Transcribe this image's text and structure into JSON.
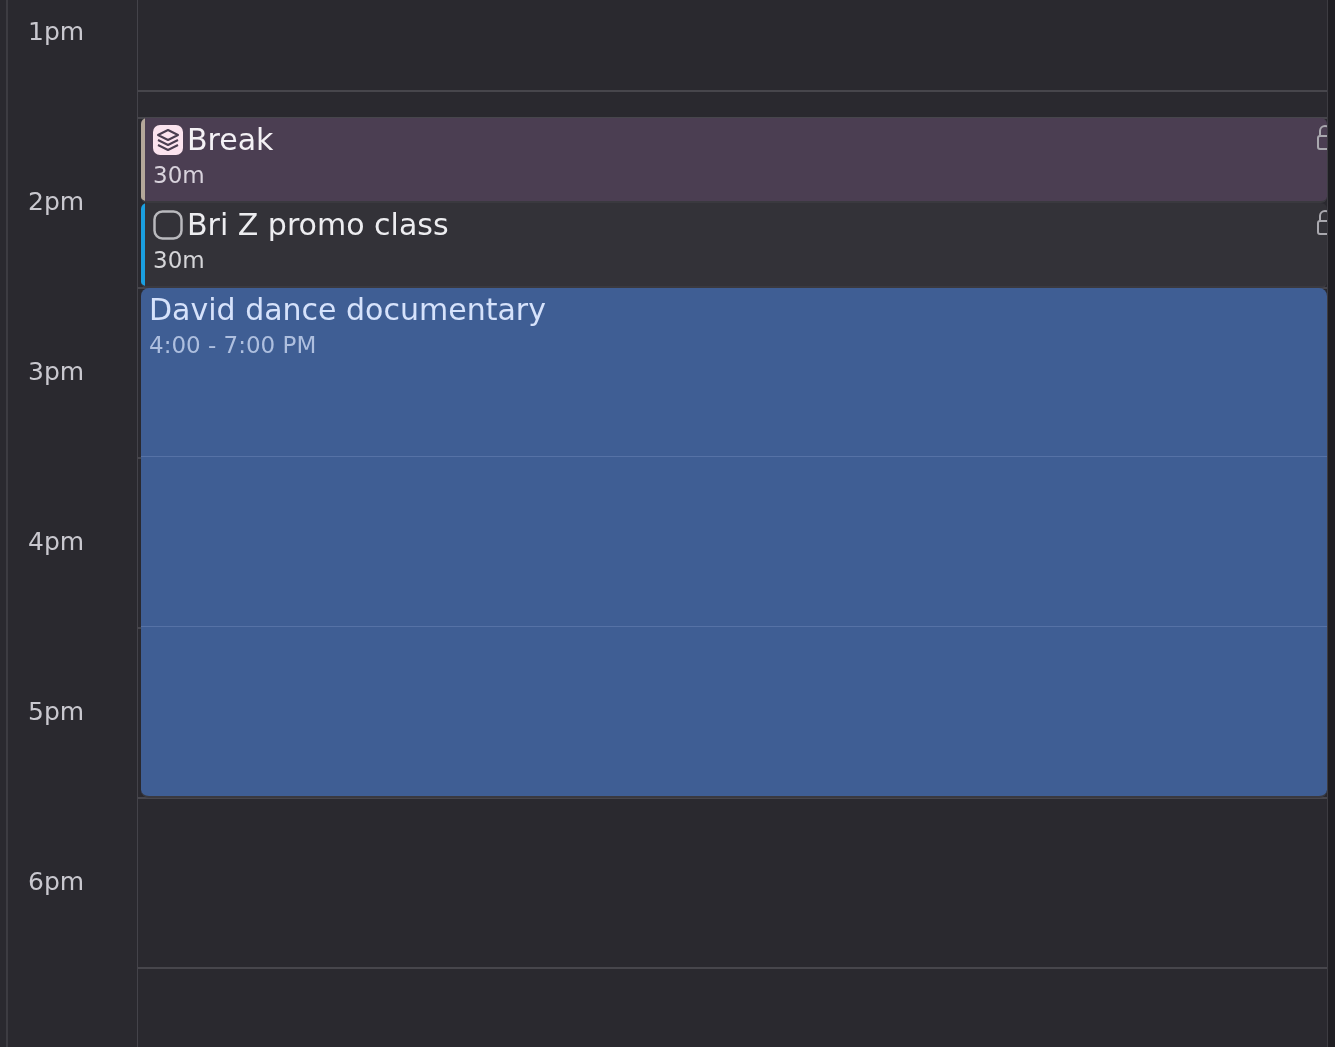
{
  "hours": [
    "1pm",
    "2pm",
    "3pm",
    "4pm",
    "5pm",
    "6pm"
  ],
  "events": [
    {
      "kind": "layered",
      "title": "Break",
      "duration": "30m",
      "color": "#b5a89a",
      "locked": true
    },
    {
      "kind": "task",
      "title": "Bri Z promo class",
      "duration": "30m",
      "color": "#1a9fe0",
      "checked": false,
      "locked": true
    },
    {
      "kind": "plain",
      "title": "David dance documentary",
      "time": "4:00 - 7:00 PM"
    }
  ]
}
